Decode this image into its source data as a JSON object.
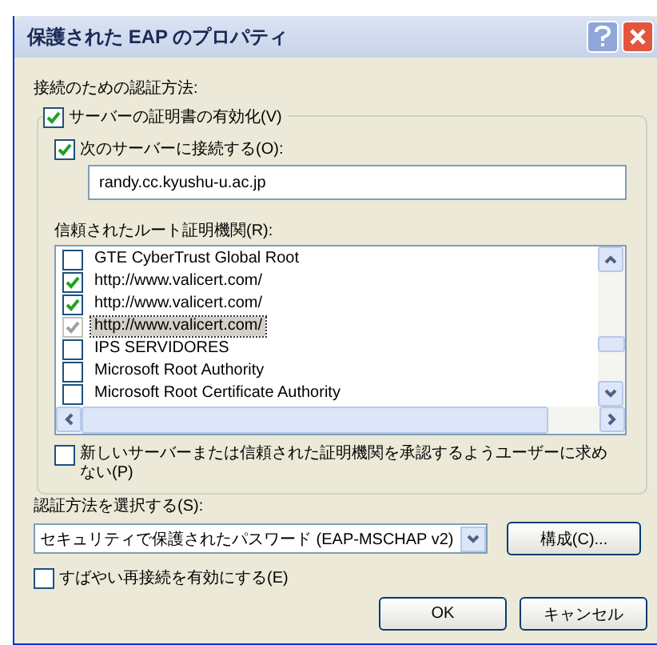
{
  "window": {
    "title": "保護された EAP のプロパティ"
  },
  "auth_label": "接続のための認証方法:",
  "validate_cert": {
    "label": "サーバーの証明書の有効化(V)",
    "checked": true
  },
  "connect_servers": {
    "label": "次のサーバーに接続する(O):",
    "checked": true
  },
  "server_field": {
    "value": "randy.cc.kyushu-u.ac.jp"
  },
  "roots_label": "信頼されたルート証明機関(R):",
  "roots": [
    {
      "label": "GTE CyberTrust Global Root",
      "checked": false,
      "selected": false,
      "disabled": false
    },
    {
      "label": "http://www.valicert.com/",
      "checked": true,
      "selected": false,
      "disabled": false
    },
    {
      "label": "http://www.valicert.com/",
      "checked": true,
      "selected": false,
      "disabled": false
    },
    {
      "label": "http://www.valicert.com/",
      "checked": true,
      "selected": true,
      "disabled": true
    },
    {
      "label": "IPS SERVIDORES",
      "checked": false,
      "selected": false,
      "disabled": false
    },
    {
      "label": "Microsoft Root Authority",
      "checked": false,
      "selected": false,
      "disabled": false
    },
    {
      "label": "Microsoft Root Certificate Authority",
      "checked": false,
      "selected": false,
      "disabled": false
    }
  ],
  "no_prompt": {
    "label": "新しいサーバーまたは信頼された証明機関を承認するようユーザーに求めない(P)",
    "checked": false
  },
  "method_label": "認証方法を選択する(S):",
  "method_select": {
    "value": "セキュリティで保護されたパスワード (EAP-MSCHAP v2)"
  },
  "configure_button": "構成(C)...",
  "fast_reconnect": {
    "label": "すばやい再接続を有効にする(E)",
    "checked": false
  },
  "buttons": [
    "OK",
    "キャンセル"
  ]
}
